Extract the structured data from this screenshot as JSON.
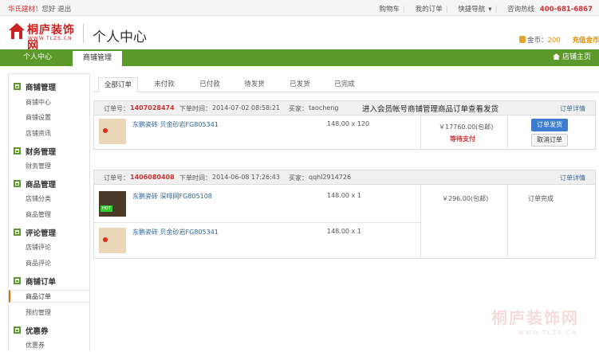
{
  "topbar": {
    "user": "华氏建材",
    "greeting": "！您好 退出",
    "links": [
      "购物车",
      "我的订单",
      "快捷导航"
    ],
    "hotline_label": "咨询热线",
    "hotline": "400-681-6867"
  },
  "header": {
    "logo_name": "桐庐装饰网",
    "logo_url": "WWW.TLZS.CN",
    "title": "个人中心",
    "coins_label": "金币：",
    "coins_value": "200",
    "recharge": "充值金币"
  },
  "nav": {
    "tabs": [
      "个人中心",
      "商铺管理"
    ],
    "active_tab": "商铺管理",
    "home": "店铺主页"
  },
  "sidebar": {
    "sections": [
      {
        "label": "商铺管理",
        "items": [
          "商铺中心",
          "商铺设置",
          "店铺资讯"
        ]
      },
      {
        "label": "财务管理",
        "items": [
          "财务管理"
        ]
      },
      {
        "label": "商品管理",
        "items": [
          "店铺分类",
          "商品管理"
        ]
      },
      {
        "label": "评论管理",
        "items": [
          "店铺评论",
          "商品评论"
        ]
      },
      {
        "label": "商铺订单",
        "items": [
          "商品订单",
          "预约管理"
        ]
      },
      {
        "label": "优惠券",
        "items": [
          "优惠券"
        ]
      }
    ],
    "active_item": "商品订单"
  },
  "order_tabs": [
    "全部订单",
    "未付款",
    "已付款",
    "待发货",
    "已发货",
    "已完成"
  ],
  "active_order_tab": "全部订单",
  "orders": [
    {
      "no_label": "订单号：",
      "no": "1407028474",
      "time_label": "下单时间：",
      "time": "2014-07-02 08:58:21",
      "buyer_label": "买家：",
      "buyer": "taocheng",
      "notice": "进入会员帐号商铺管理商品订单查看发货",
      "detail": "订单详情",
      "items": [
        {
          "name": "东鹏瓷砖 贝金砂岩FG805341",
          "qty": "148.00 x 120"
        }
      ],
      "total": "￥17760.00(包邮)",
      "state": "等待支付",
      "ship_button": "订单发货",
      "cancel_button": "取消订单"
    },
    {
      "no_label": "订单号：",
      "no": "1406080408",
      "time_label": "下单时间：",
      "time": "2014-06-08 17:26:43",
      "buyer_label": "买家：",
      "buyer": "qqhl2914726",
      "detail": "订单详情",
      "items": [
        {
          "name": "东鹏瓷砖 深啡网FG805108",
          "qty": "148.00 x 1"
        },
        {
          "name": "东鹏瓷砖 贝金砂岩FG805341",
          "qty": "148.00 x 1"
        }
      ],
      "total": "￥296.00(包邮)",
      "state": "订单完成"
    }
  ],
  "watermark": {
    "name": "桐庐装饰网",
    "url": "WWW.TLZS.CN"
  }
}
